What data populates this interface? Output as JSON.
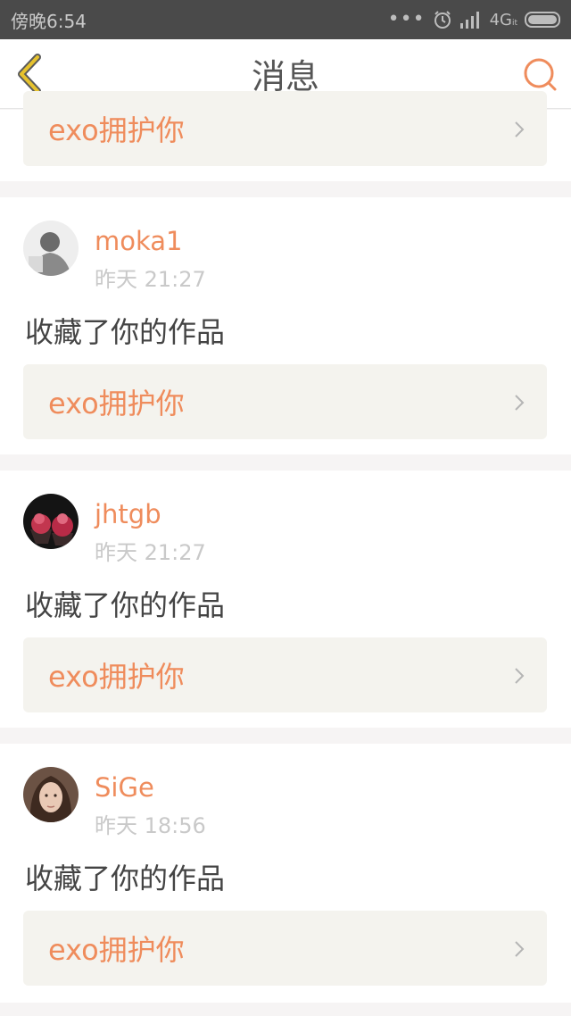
{
  "status_bar": {
    "time": "傍晚6:54",
    "network": "4G",
    "network_sub": "it"
  },
  "header": {
    "title": "消息"
  },
  "top_card": {
    "work_title": "exo拥护你"
  },
  "messages": [
    {
      "username": "moka1",
      "time": "昨天 21:27",
      "action": "收藏了你的作品",
      "work_title": "exo拥护你"
    },
    {
      "username": "jhtgb",
      "time": "昨天 21:27",
      "action": "收藏了你的作品",
      "work_title": "exo拥护你"
    },
    {
      "username": "SiGe",
      "time": "昨天 18:56",
      "action": "收藏了你的作品",
      "work_title": "exo拥护你"
    }
  ],
  "colors": {
    "accent": "#ef8c5c",
    "back_icon": "#e6c22e",
    "status_bar_bg": "#4a4a4a",
    "card_link_bg": "#f4f3ee"
  },
  "icons": {
    "back": "chevron-left-icon",
    "search": "search-icon",
    "row_arrow": "chevron-right-icon"
  }
}
